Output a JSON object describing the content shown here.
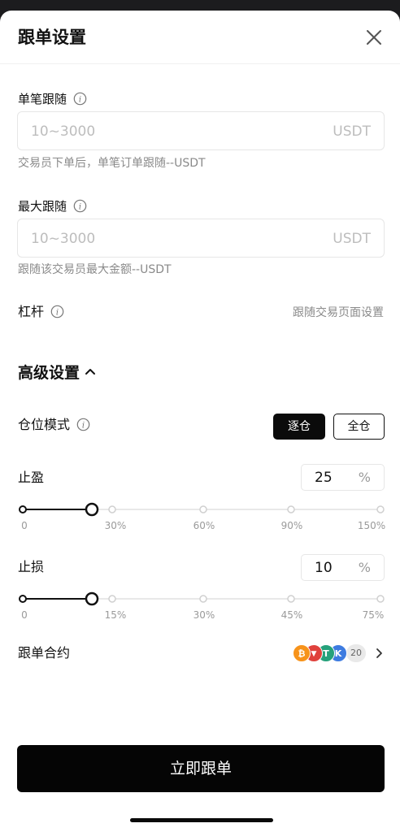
{
  "header": {
    "title": "跟单设置"
  },
  "single_follow": {
    "label": "单笔跟随",
    "placeholder": "10~3000",
    "unit": "USDT",
    "hint": "交易员下单后，单笔订单跟随--USDT"
  },
  "max_follow": {
    "label": "最大跟随",
    "placeholder": "10~3000",
    "unit": "USDT",
    "hint": "跟随该交易员最大金额--USDT"
  },
  "leverage": {
    "label": "杠杆",
    "value": "跟随交易页面设置"
  },
  "advanced": {
    "title": "高级设置"
  },
  "position_mode": {
    "label": "仓位模式",
    "options": [
      "逐仓",
      "全仓"
    ],
    "selected": "逐仓"
  },
  "take_profit": {
    "label": "止盈",
    "value": "25",
    "unit": "%",
    "ticks": [
      "0",
      "30%",
      "60%",
      "90%",
      "150%"
    ]
  },
  "stop_loss": {
    "label": "止损",
    "value": "10",
    "unit": "%",
    "ticks": [
      "0",
      "15%",
      "30%",
      "45%",
      "75%"
    ]
  },
  "contracts": {
    "label": "跟单合约",
    "coins": [
      {
        "symbol": "₿",
        "color": "#f7931a",
        "icon": "bitcoin-icon"
      },
      {
        "symbol": "▼",
        "color": "#e0413c",
        "icon": "tron-icon"
      },
      {
        "symbol": "T",
        "color": "#26a17b",
        "icon": "tether-icon"
      },
      {
        "symbol": "K",
        "color": "#3d7be0",
        "icon": "k-coin-icon"
      }
    ],
    "count": "20"
  },
  "cta": {
    "label": "立即跟单"
  },
  "colors": {
    "primary": "#050505",
    "hint": "#8a8a8a",
    "border": "#e6e6e6"
  }
}
